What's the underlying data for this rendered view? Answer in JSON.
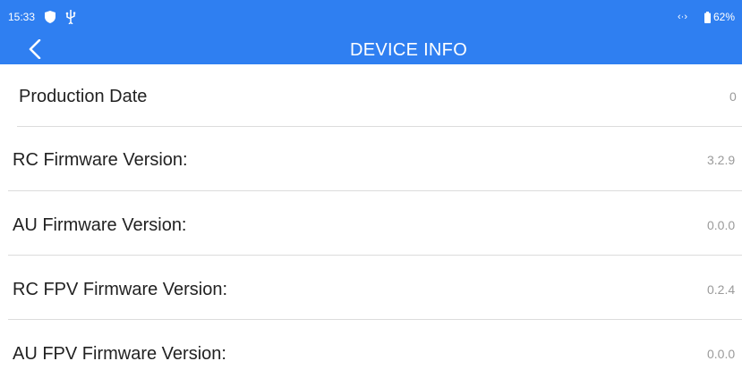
{
  "status_bar": {
    "time": "15:33",
    "link_glyph": "‹·›",
    "battery": "62%",
    "icons": [
      "shield-icon",
      "usb-icon",
      "link-icon",
      "battery-icon"
    ]
  },
  "header": {
    "back_icon": "chevron-left-icon",
    "title": "DEVICE INFO",
    "color": "#2f7ff1"
  },
  "rows": [
    {
      "label": "Production Date",
      "value": "0"
    },
    {
      "label": "RC Firmware Version:",
      "value": "3.2.9"
    },
    {
      "label": "AU Firmware Version:",
      "value": "0.0.0"
    },
    {
      "label": "RC FPV Firmware Version:",
      "value": "0.2.4"
    },
    {
      "label": "AU FPV Firmware Version:",
      "value": "0.0.0"
    }
  ]
}
